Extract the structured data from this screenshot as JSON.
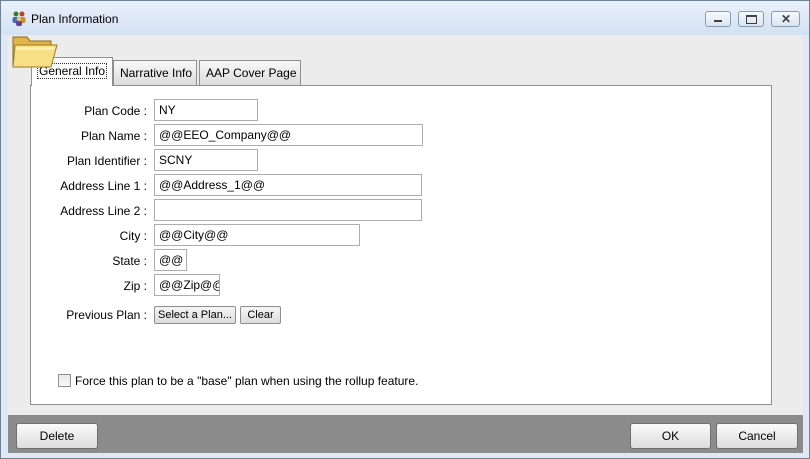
{
  "window": {
    "title": "Plan Information"
  },
  "tabs": [
    {
      "label": "General Info",
      "selected": true
    },
    {
      "label": "Narrative Info",
      "selected": false
    },
    {
      "label": "AAP Cover Page",
      "selected": false
    }
  ],
  "form": {
    "plan_code": {
      "label": "Plan Code :",
      "value": "NY"
    },
    "plan_name": {
      "label": "Plan Name :",
      "value": "@@EEO_Company@@"
    },
    "plan_identifier": {
      "label": "Plan Identifier :",
      "value": "SCNY"
    },
    "address_line_1": {
      "label": "Address Line 1 :",
      "value": "@@Address_1@@"
    },
    "address_line_2": {
      "label": "Address Line 2 :",
      "value": ""
    },
    "city": {
      "label": "City :",
      "value": "@@City@@"
    },
    "state": {
      "label": "State :",
      "value": "@@"
    },
    "zip": {
      "label": "Zip :",
      "value": "@@Zip@@"
    },
    "previous_plan": {
      "label": "Previous Plan :",
      "select_label": "Select a Plan...",
      "clear_label": "Clear"
    },
    "rollup": {
      "label": "Force this plan to be a \"base\" plan when using the rollup feature.",
      "checked": false
    }
  },
  "footer": {
    "delete_label": "Delete",
    "ok_label": "OK",
    "cancel_label": "Cancel"
  },
  "icons": {
    "app": "people-icon",
    "folder": "open-folder-icon",
    "minimize": "minimize-icon",
    "maximize": "maximize-icon",
    "close": "close-icon"
  }
}
